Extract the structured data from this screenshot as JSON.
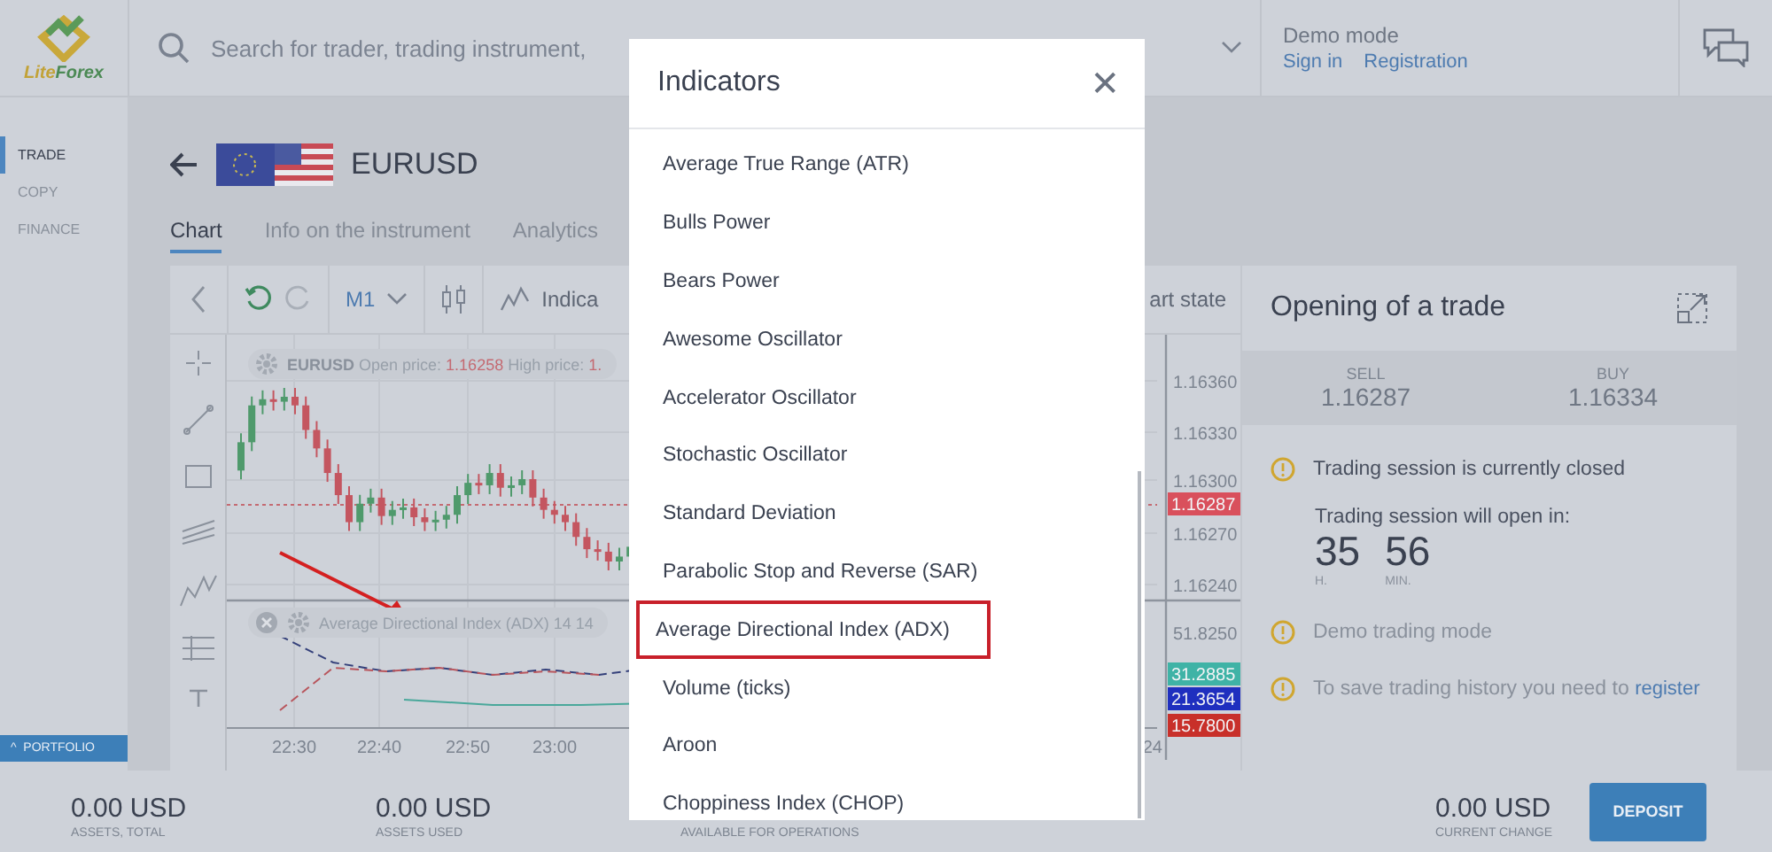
{
  "header": {
    "logo": {
      "part1": "Lite",
      "part2": "Forex"
    },
    "search": {
      "placeholder": "Search for trader, trading instrument,"
    },
    "account": {
      "mode": "Demo mode",
      "links": [
        "Sign in",
        "Registration"
      ]
    }
  },
  "sidebar": {
    "items": [
      {
        "label": "TRADE",
        "selected": true
      },
      {
        "label": "COPY",
        "selected": false
      },
      {
        "label": "FINANCE",
        "selected": false
      }
    ],
    "portfolio": {
      "icon": "^",
      "label": "PORTFOLIO"
    }
  },
  "instrument": {
    "symbol": "EURUSD"
  },
  "tabs": [
    {
      "label": "Chart",
      "selected": true
    },
    {
      "label": "Info on the instrument",
      "selected": false
    },
    {
      "label": "Analytics",
      "selected": false
    }
  ],
  "chart": {
    "timeframe": "M1",
    "indicators_button": "Indica",
    "state_button": "art state",
    "legend": {
      "symbol": "EURUSD",
      "open_label": "Open price:",
      "open_value": "1.16258",
      "high_label": "High price:",
      "high_value": "1."
    },
    "indicator_legend": "Average Directional Index (ADX) 14 14",
    "price_ticks": [
      "1.16360",
      "1.16330",
      "1.16300",
      "1.16270",
      "1.16240"
    ],
    "price_tag": {
      "text": "1.16287",
      "color": "#d9505c"
    },
    "indicator_ticks": [
      "51.8250"
    ],
    "indicator_tags": [
      {
        "text": "31.2885",
        "color": "#3fb3a6"
      },
      {
        "text": "21.3654",
        "color": "#1f2fbf"
      },
      {
        "text": "15.7800",
        "color": "#c8302a"
      }
    ],
    "time_ticks": [
      "22:30",
      "22:40",
      "22:50",
      "23:00",
      "24"
    ]
  },
  "trade": {
    "title": "Opening of a trade",
    "sell": {
      "label": "SELL",
      "price": "1.16287"
    },
    "buy": {
      "label": "BUY",
      "price": "1.16334"
    },
    "closed_notice": "Trading session is currently closed",
    "opens_in": "Trading session will open in:",
    "countdown": [
      {
        "value": "35",
        "unit": "H."
      },
      {
        "value": "56",
        "unit": "MIN."
      }
    ],
    "demo_notice": "Demo trading mode",
    "history_notice": "To save trading history you need to",
    "history_link": "register"
  },
  "footer": {
    "stats": [
      {
        "value": "0.00 USD",
        "label": "ASSETS, TOTAL"
      },
      {
        "value": "0.00 USD",
        "label": "ASSETS USED"
      },
      {
        "label": "AVAILABLE FOR OPERATIONS"
      }
    ],
    "change": {
      "value": "0.00 USD",
      "label": "CURRENT CHANGE"
    },
    "deposit": "DEPOSIT"
  },
  "modal": {
    "title": "Indicators",
    "close": "✕",
    "items": [
      {
        "label": "Average True Range (ATR)",
        "selected": false
      },
      {
        "label": "Bulls Power",
        "selected": false
      },
      {
        "label": "Bears Power",
        "selected": false
      },
      {
        "label": "Awesome Oscillator",
        "selected": false
      },
      {
        "label": "Accelerator Oscillator",
        "selected": false
      },
      {
        "label": "Stochastic Oscillator",
        "selected": false
      },
      {
        "label": "Standard Deviation",
        "selected": false
      },
      {
        "label": "Parabolic Stop and Reverse (SAR)",
        "selected": false
      },
      {
        "label": "Average Directional Index (ADX)",
        "selected": true
      },
      {
        "label": "Volume (ticks)",
        "selected": false
      },
      {
        "label": "Aroon",
        "selected": false
      },
      {
        "label": "Choppiness Index (CHOP)",
        "selected": false
      }
    ]
  }
}
